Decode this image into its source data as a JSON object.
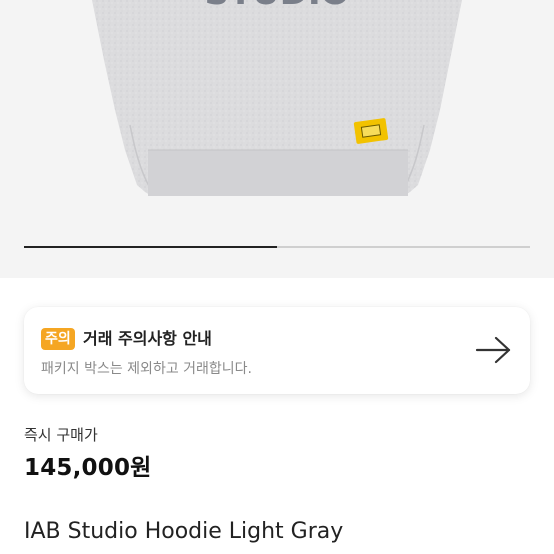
{
  "gallery": {
    "progress_fraction": 0.5
  },
  "notice": {
    "badge": "주의",
    "title": "거래 주의사항 안내",
    "description": "패키지 박스는 제외하고 거래합니다."
  },
  "purchase": {
    "label": "즉시 구매가",
    "price": "145,000원"
  },
  "product": {
    "name": "IAB Studio Hoodie Light Gray"
  },
  "colors": {
    "accent": "#f5a623",
    "hoodie": "#d9d9db",
    "tag": "#f2c200"
  }
}
